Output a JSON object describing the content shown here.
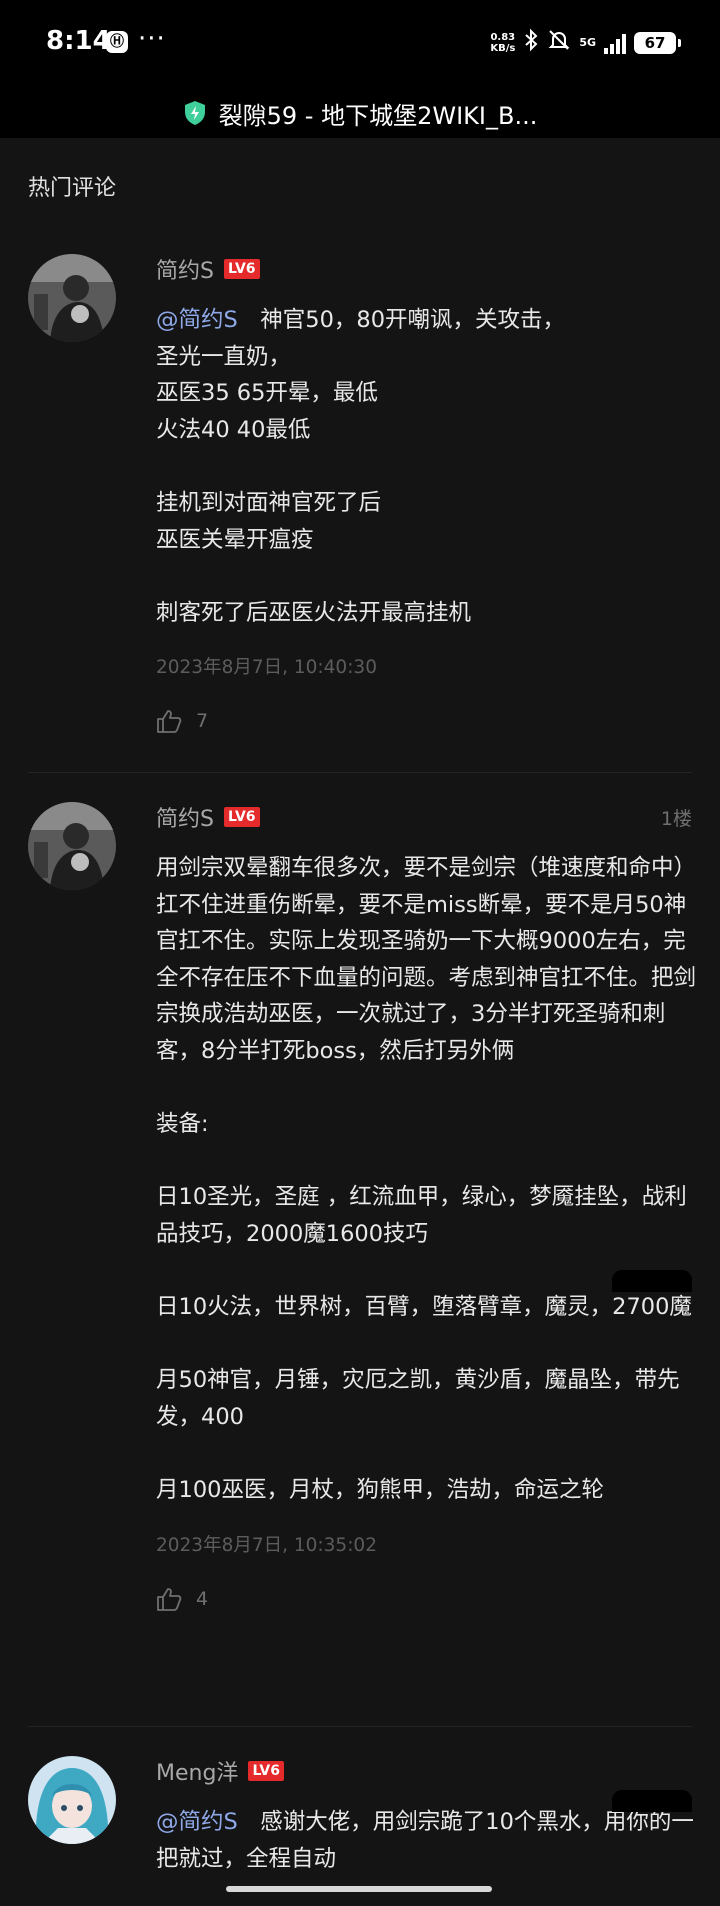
{
  "status_bar": {
    "time": "8:14",
    "app_icon": "Ⓗ",
    "more": "···",
    "speed_value": "0.83",
    "speed_unit": "KB/s",
    "network": "5G",
    "battery": "67"
  },
  "title_bar": {
    "title": "裂隙59 - 地下城堡2WIKI_B...",
    "shield_color": "#3ecf9a"
  },
  "section_title": "热门评论",
  "level_badge": "LV6",
  "comments": [
    {
      "user": "简约S",
      "floor": "",
      "mention": "@简约S",
      "text": "　神官50，80开嘲讽，关攻击，\n圣光一直奶，\n巫医35 65开晕，最低\n火法40 40最低\n\n挂机到对面神官死了后\n巫医关晕开瘟疫\n\n刺客死了后巫医火法开最高挂机",
      "time": "2023年8月7日, 10:40:30",
      "likes": "7"
    },
    {
      "user": "简约S",
      "floor": "1楼",
      "mention": "",
      "text": "用剑宗双晕翻车很多次，要不是剑宗（堆速度和命中）扛不住进重伤断晕，要不是miss断晕，要不是月50神官扛不住。实际上发现圣骑奶一下大概9000左右，完全不存在压不下血量的问题。考虑到神官扛不住。把剑宗换成浩劫巫医，一次就过了，3分半打死圣骑和刺客，8分半打死boss，然后打另外俩\n\n装备:\n\n日10圣光，圣庭 ，红流血甲，绿心，梦魇挂坠，战利品技巧，2000魔1600技巧\n\n日10火法，世界树，百臂，堕落臂章，魔灵，2700魔\n\n月50神官，月锤，灾厄之凯，黄沙盾，魔晶坠，带先发，400\n\n月100巫医，月杖，狗熊甲，浩劫，命运之轮",
      "time": "2023年8月7日, 10:35:02",
      "likes": "4"
    },
    {
      "user": "Meng洋",
      "floor": "",
      "mention": "@简约S",
      "text": "　感谢大佬，用剑宗跪了10个黑水，用你的一把就过，全程自动",
      "time": "",
      "likes": ""
    }
  ]
}
